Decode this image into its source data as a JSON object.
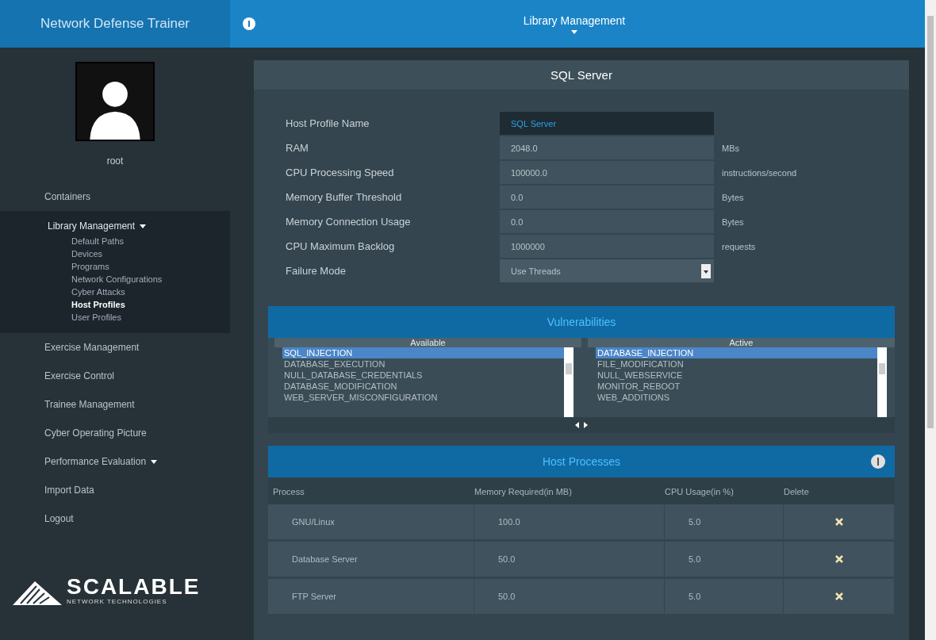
{
  "app_title": "Network Defense Trainer",
  "page_title": "Library Management",
  "user": {
    "name": "root"
  },
  "sidebar": {
    "items": [
      {
        "label": "Containers",
        "selected": false,
        "expandable": false
      },
      {
        "label": "Library Management",
        "selected": true,
        "expandable": true,
        "children": [
          {
            "label": "Default Paths",
            "selected": false
          },
          {
            "label": "Devices",
            "selected": false
          },
          {
            "label": "Programs",
            "selected": false
          },
          {
            "label": "Network Configurations",
            "selected": false
          },
          {
            "label": "Cyber Attacks",
            "selected": false
          },
          {
            "label": "Host Profiles",
            "selected": true
          },
          {
            "label": "User Profiles",
            "selected": false
          }
        ]
      },
      {
        "label": "Exercise Management",
        "selected": false,
        "expandable": false
      },
      {
        "label": "Exercise Control",
        "selected": false,
        "expandable": false
      },
      {
        "label": "Trainee Management",
        "selected": false,
        "expandable": false
      },
      {
        "label": "Cyber Operating Picture",
        "selected": false,
        "expandable": false
      },
      {
        "label": "Performance Evaluation",
        "selected": false,
        "expandable": true
      },
      {
        "label": "Import Data",
        "selected": false,
        "expandable": false
      },
      {
        "label": "Logout",
        "selected": false,
        "expandable": false
      }
    ]
  },
  "logo": {
    "name": "SCALABLE",
    "tagline": "NETWORK TECHNOLOGIES"
  },
  "profile": {
    "title": "SQL Server",
    "fields": [
      {
        "kind": "text",
        "label": "Host Profile Name",
        "value": "SQL Server",
        "focused": true
      },
      {
        "kind": "text",
        "label": "RAM",
        "value": "2048.0",
        "unit": "MBs",
        "focused": false
      },
      {
        "kind": "text",
        "label": "CPU Processing Speed",
        "value": "100000.0",
        "unit": "instructions/second",
        "focused": false
      },
      {
        "kind": "text",
        "label": "Memory Buffer Threshold",
        "value": "0.0",
        "unit": "Bytes",
        "focused": false
      },
      {
        "kind": "text",
        "label": "Memory Connection Usage",
        "value": "0.0",
        "unit": "Bytes",
        "focused": false
      },
      {
        "kind": "text",
        "label": "CPU Maximum Backlog",
        "value": "1000000",
        "unit": "requests",
        "focused": false
      },
      {
        "kind": "select",
        "label": "Failure Mode",
        "value": "Use Threads",
        "focused": false
      }
    ]
  },
  "vulnerabilities": {
    "title": "Vulnerabilities",
    "lists": [
      {
        "heading": "Available",
        "items": [
          {
            "label": "SQL_INJECTION",
            "selected": true
          },
          {
            "label": "DATABASE_EXECUTION",
            "selected": false
          },
          {
            "label": "NULL_DATABASE_CREDENTIALS",
            "selected": false
          },
          {
            "label": "DATABASE_MODIFICATION",
            "selected": false
          },
          {
            "label": "WEB_SERVER_MISCONFIGURATION",
            "selected": false
          }
        ]
      },
      {
        "heading": "Active",
        "items": [
          {
            "label": "DATABASE_INJECTION",
            "selected": true
          },
          {
            "label": "FILE_MODIFICATION",
            "selected": false
          },
          {
            "label": "NULL_WEBSERVICE",
            "selected": false
          },
          {
            "label": "MONITOR_REBOOT",
            "selected": false
          },
          {
            "label": "WEB_ADDITIONS",
            "selected": false
          }
        ]
      }
    ]
  },
  "processes": {
    "title": "Host Processes",
    "columns": [
      "Process",
      "Memory Required(in MB)",
      "CPU Usage(in %)",
      "Delete"
    ],
    "rows": [
      {
        "process": "GNU/Linux",
        "memory": "100.0",
        "cpu": "5.0"
      },
      {
        "process": "Database Server",
        "memory": "50.0",
        "cpu": "5.0"
      },
      {
        "process": "FTP Server",
        "memory": "50.0",
        "cpu": "5.0"
      }
    ]
  }
}
